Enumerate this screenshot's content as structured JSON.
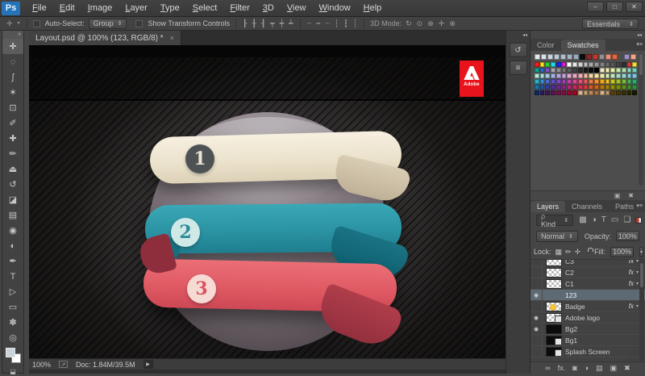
{
  "window": {
    "controls": [
      {
        "name": "minimize-button",
        "glyph": "–"
      },
      {
        "name": "maximize-button",
        "glyph": "□"
      },
      {
        "name": "close-button",
        "glyph": "✕"
      }
    ]
  },
  "menu": {
    "logo": "Ps",
    "items": [
      "File",
      "Edit",
      "Image",
      "Layer",
      "Type",
      "Select",
      "Filter",
      "3D",
      "View",
      "Window",
      "Help"
    ]
  },
  "options": {
    "tool_icon_glyph": "✛",
    "auto_select_label": "Auto-Select:",
    "auto_select_value": "Group",
    "show_transform_label": "Show Transform Controls",
    "align_icons": [
      {
        "name": "align-left-edges-icon",
        "glyph": "┠"
      },
      {
        "name": "align-horizontal-centers-icon",
        "glyph": "╂"
      },
      {
        "name": "align-right-edges-icon",
        "glyph": "┨"
      },
      {
        "name": "align-top-edges-icon",
        "glyph": "┯"
      },
      {
        "name": "align-vertical-centers-icon",
        "glyph": "┿"
      },
      {
        "name": "align-bottom-edges-icon",
        "glyph": "┷"
      }
    ],
    "distribute_icons": [
      {
        "name": "distribute-top-edges-icon",
        "glyph": "┄"
      },
      {
        "name": "distribute-vertical-centers-icon",
        "glyph": "┅"
      },
      {
        "name": "distribute-bottom-edges-icon",
        "glyph": "┈"
      },
      {
        "name": "distribute-left-edges-icon",
        "glyph": "┆"
      },
      {
        "name": "distribute-horizontal-centers-icon",
        "glyph": "┇"
      },
      {
        "name": "distribute-right-edges-icon",
        "glyph": "┊"
      }
    ],
    "mode_3d_label": "3D Mode:",
    "mode_3d_icons": [
      {
        "name": "3d-rotate-icon",
        "glyph": "↻"
      },
      {
        "name": "3d-roll-icon",
        "glyph": "⊙"
      },
      {
        "name": "3d-drag-icon",
        "glyph": "⊕"
      },
      {
        "name": "3d-slide-icon",
        "glyph": "✛"
      },
      {
        "name": "3d-scale-icon",
        "glyph": "⊗"
      }
    ],
    "workspace": "Essentials"
  },
  "tools": [
    {
      "name": "move-tool",
      "glyph": "✛",
      "selected": true
    },
    {
      "name": "marquee-tool",
      "glyph": "◌"
    },
    {
      "name": "lasso-tool",
      "glyph": "ʃ"
    },
    {
      "name": "magic-wand-tool",
      "glyph": "✶"
    },
    {
      "name": "crop-tool",
      "glyph": "⊡"
    },
    {
      "name": "eyedropper-tool",
      "glyph": "✐"
    },
    {
      "name": "healing-brush-tool",
      "glyph": "✚"
    },
    {
      "name": "brush-tool",
      "glyph": "✏"
    },
    {
      "name": "clone-stamp-tool",
      "glyph": "⏏"
    },
    {
      "name": "history-brush-tool",
      "glyph": "↺"
    },
    {
      "name": "eraser-tool",
      "glyph": "◪"
    },
    {
      "name": "gradient-tool",
      "glyph": "▤"
    },
    {
      "name": "blur-tool",
      "glyph": "◉"
    },
    {
      "name": "dodge-tool",
      "glyph": "◐"
    },
    {
      "name": "pen-tool",
      "glyph": "✒"
    },
    {
      "name": "type-tool",
      "glyph": "T"
    },
    {
      "name": "path-selection-tool",
      "glyph": "▷"
    },
    {
      "name": "shape-tool",
      "glyph": "▭"
    },
    {
      "name": "hand-tool",
      "glyph": "✽"
    },
    {
      "name": "zoom-tool",
      "glyph": "◎"
    }
  ],
  "tool_colors": {
    "foreground": "#c9d3da",
    "background": "#ffffff"
  },
  "document": {
    "tab_title": "Layout.psd @ 100% (123, RGB/8) *",
    "close": "×"
  },
  "canvas": {
    "adobe_logo_text": "Adobe",
    "ribbons": [
      {
        "number": "1",
        "circle_bg": "#4d5355",
        "number_color": "#ece4d2"
      },
      {
        "number": "2",
        "circle_bg": "#cfe9e7",
        "number_color": "#2d8a99"
      },
      {
        "number": "3",
        "circle_bg": "#f6dbd5",
        "number_color": "#d9545e"
      }
    ],
    "colors": {
      "ribbon1": "#ece4d2",
      "ribbon2": "#2d96a6",
      "ribbon3": "#e25d66",
      "sphere": "#7e747b",
      "background": "#1c1a1a",
      "logo_red": "#e8131b"
    }
  },
  "dock_buttons": [
    {
      "name": "history-panel-icon",
      "glyph": "↺"
    },
    {
      "name": "properties-panel-icon",
      "glyph": "≡"
    }
  ],
  "swatches_panel": {
    "tabs": [
      "Color",
      "Swatches"
    ],
    "active_tab": "Swatches",
    "recent": [
      "#e4e9ee",
      "#d8dfe6",
      "#cbd5dd",
      "#bfcad4",
      "#b2c0cb",
      "#a6b5c2",
      "#99abb9",
      "#0c0c0c",
      "#8c2727",
      "#c23a2e",
      "#909090",
      "#ea9078",
      "#e5693f"
    ],
    "recent_pair": [
      "#9e90c2",
      "#f2a88e"
    ],
    "grid": [
      [
        "#ff1a1a",
        "#ffe81a",
        "#2ad42a",
        "#1ae0e0",
        "#2424e8",
        "#e01ae0",
        "#ffffff",
        "#e8e8e8",
        "#d4d4d4",
        "#bfbfbf",
        "#ababab",
        "#969696",
        "#828282",
        "#6d6d6d",
        "#595959",
        "#444444",
        "#303030",
        "#e03a3a",
        "#f0e03a"
      ],
      [
        "#14a08a",
        "#2f6fc4",
        "#7a4fd0",
        "#a8a8a8",
        "#8f8f8f",
        "#757575",
        "#5c5c5c",
        "#434343",
        "#2b2b2b",
        "#1a1a1a",
        "#0d0d0d",
        "#000000",
        "#f0ecc8",
        "#f4f0b0",
        "#e4f0ac",
        "#c8e8ac",
        "#acdcb0",
        "#90d4b4",
        "#78ccb8"
      ],
      [
        "#b8e8d8",
        "#a8e0e4",
        "#a0cce8",
        "#a4b4e4",
        "#b4a8e0",
        "#cca8dc",
        "#e0a8d4",
        "#eca8c4",
        "#f0b0b4",
        "#f4c0a8",
        "#f8d4a4",
        "#f8e4a8",
        "#f0ecb0",
        "#d8ecb4",
        "#c0e4bc",
        "#a8dcc4",
        "#98d4cc",
        "#88ccd8",
        "#80c4e0"
      ],
      [
        "#28b4c8",
        "#3890d8",
        "#4868d0",
        "#6050c8",
        "#8048c0",
        "#a040b8",
        "#c040a8",
        "#d84890",
        "#e05078",
        "#e86060",
        "#ec7848",
        "#f09030",
        "#f0a820",
        "#e8c020",
        "#c8c428",
        "#a0c030",
        "#78b840",
        "#50b058",
        "#30a878"
      ],
      [
        "#1878a8",
        "#2058a8",
        "#3040a0",
        "#503098",
        "#702890",
        "#902888",
        "#b02878",
        "#c82860",
        "#d83050",
        "#e04040",
        "#d85828",
        "#c86818",
        "#b87810",
        "#a88808",
        "#909008",
        "#789010",
        "#609018",
        "#489030",
        "#309048"
      ],
      [
        "#102868",
        "#281c60",
        "#401858",
        "#581450",
        "#701048",
        "#880c40",
        "#980830",
        "#a80420",
        "#d8b890",
        "#cba276",
        "#b98a5a",
        "#a87444",
        "#d2b48c",
        "#c09868",
        "#584010",
        "#483808",
        "#383008",
        "#282800",
        "#181800"
      ]
    ],
    "bottom_icons": [
      {
        "name": "new-swatch-icon",
        "glyph": "▣"
      },
      {
        "name": "delete-swatch-icon",
        "glyph": "✖"
      }
    ]
  },
  "layers_panel": {
    "tabs": [
      "Layers",
      "Channels",
      "Paths"
    ],
    "active_tab": "Layers",
    "filter_label": "Kind",
    "filter_icons": [
      {
        "name": "filter-pixel-layers-icon",
        "glyph": "▩"
      },
      {
        "name": "filter-adjustment-layers-icon",
        "glyph": "◑"
      },
      {
        "name": "filter-type-layers-icon",
        "glyph": "T"
      },
      {
        "name": "filter-shape-layers-icon",
        "glyph": "▭"
      },
      {
        "name": "filter-smart-objects-icon",
        "glyph": "❏"
      }
    ],
    "blend_mode": "Normal",
    "opacity_label": "Opacity:",
    "opacity_value": "100%",
    "lock_label": "Lock:",
    "lock_icons": [
      {
        "name": "lock-transparency-icon",
        "glyph": "▦"
      },
      {
        "name": "lock-pixels-icon",
        "glyph": "✏"
      },
      {
        "name": "lock-position-icon",
        "glyph": "✛"
      }
    ],
    "fill_label": "Fill:",
    "fill_value": "100%",
    "layers": [
      {
        "name": "C3",
        "eye": false,
        "fx": true,
        "thumb": "checker",
        "smart": false,
        "selected": false,
        "clipped": true
      },
      {
        "name": "C2",
        "eye": false,
        "fx": true,
        "thumb": "checker",
        "smart": false,
        "selected": false
      },
      {
        "name": "C1",
        "eye": false,
        "fx": true,
        "thumb": "checker",
        "smart": false,
        "selected": false
      },
      {
        "name": "123",
        "eye": true,
        "fx": false,
        "thumb": "sphere",
        "smart": false,
        "selected": true
      },
      {
        "name": "Badge",
        "eye": false,
        "fx": true,
        "thumb": "badge",
        "smart": false,
        "selected": false
      },
      {
        "name": "Adobe logo",
        "eye": true,
        "fx": false,
        "thumb": "checker",
        "smart": true,
        "selected": false
      },
      {
        "name": "Bg2",
        "eye": true,
        "fx": false,
        "thumb": "black",
        "smart": false,
        "selected": false
      },
      {
        "name": "Bg1",
        "eye": false,
        "fx": false,
        "thumb": "black",
        "smart": true,
        "selected": false
      },
      {
        "name": "Splash Screen",
        "eye": false,
        "fx": false,
        "thumb": "black",
        "smart": true,
        "selected": false
      }
    ],
    "bottom_icons": [
      {
        "name": "link-layers-icon",
        "glyph": "∞"
      },
      {
        "name": "layer-style-icon",
        "glyph": "fx."
      },
      {
        "name": "add-layer-mask-icon",
        "glyph": "◙"
      },
      {
        "name": "new-adjustment-layer-icon",
        "glyph": "◑"
      },
      {
        "name": "new-group-icon",
        "glyph": "▤"
      },
      {
        "name": "new-layer-icon",
        "glyph": "▣"
      },
      {
        "name": "delete-layer-icon",
        "glyph": "✖"
      }
    ]
  },
  "status": {
    "zoom": "100%",
    "doc": "Doc: 1.84M/39.5M"
  }
}
